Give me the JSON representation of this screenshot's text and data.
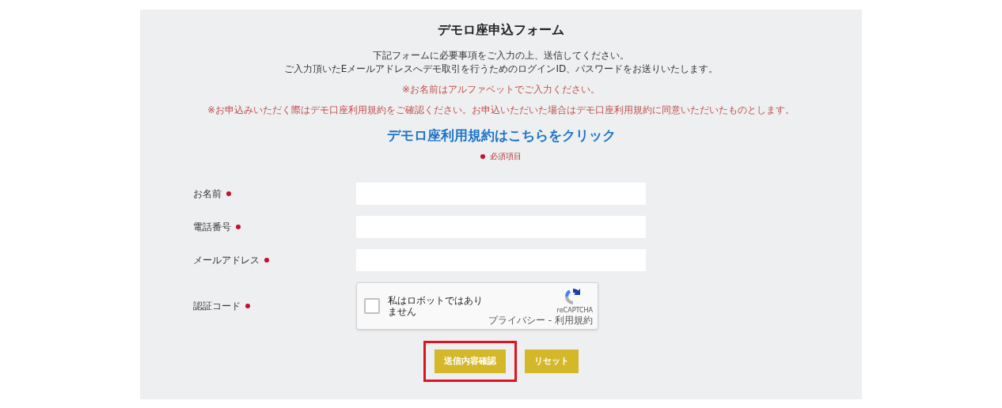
{
  "title": "デモロ座申込フォーム",
  "intro": [
    "下記フォームに必要事項をご入力の上、送信してください。",
    "ご入力頂いたEメールアドレスへデモ取引を行うためのログインID、パスワードをお送りいたします。"
  ],
  "notices": [
    "※お名前はアルファベットでご入力ください。",
    "※お申込みいただく際はデモ口座利用規約をご確認ください。お申込いただいた場合はデモ口座利用規約に同意いただいたものとします。"
  ],
  "terms_link": "デモロ座利用規約はこちらをクリック",
  "required_legend": "必須項目",
  "fields": [
    {
      "kind": "text",
      "label": "お名前",
      "required": true
    },
    {
      "kind": "text",
      "label": "電話番号",
      "required": true
    },
    {
      "kind": "text",
      "label": "メールアドレス",
      "required": true
    },
    {
      "kind": "captcha",
      "label": "認証コード",
      "required": true,
      "checked": false,
      "text": "私はロボットではありません",
      "brand": "reCAPTCHA",
      "footer": "プライバシー - 利用規約"
    }
  ],
  "buttons": [
    {
      "label": "送信内容確認",
      "highlighted": true
    },
    {
      "label": "リセット",
      "highlighted": false
    }
  ]
}
